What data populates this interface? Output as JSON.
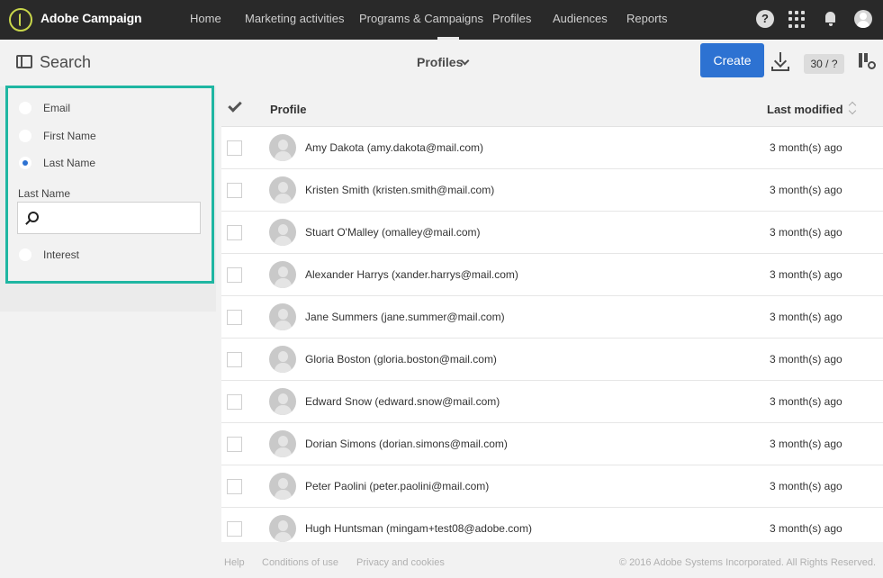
{
  "app": {
    "brand": "Adobe Campaign"
  },
  "nav": {
    "items": [
      {
        "label": "Home"
      },
      {
        "label": "Marketing activities"
      },
      {
        "label": "Programs & Campaigns"
      },
      {
        "label": "Profiles"
      },
      {
        "label": "Audiences"
      },
      {
        "label": "Reports"
      }
    ],
    "help_glyph": "?"
  },
  "toolbar": {
    "search_title": "Search",
    "view_selector": "Profiles",
    "create_label": "Create",
    "count": "30 / ?"
  },
  "filters": {
    "options": [
      {
        "label": "Email",
        "selected": false
      },
      {
        "label": "First Name",
        "selected": false
      },
      {
        "label": "Last Name",
        "selected": true
      },
      {
        "label": "Interest",
        "selected": false
      }
    ],
    "active_field_label": "Last Name",
    "search_value": ""
  },
  "table": {
    "columns": [
      "Profile",
      "Last modified"
    ],
    "rows": [
      {
        "name": "Amy Dakota (amy.dakota@mail.com)",
        "modified": "3 month(s) ago"
      },
      {
        "name": "Kristen Smith (kristen.smith@mail.com)",
        "modified": "3 month(s) ago"
      },
      {
        "name": "Stuart O'Malley (omalley@mail.com)",
        "modified": "3 month(s) ago"
      },
      {
        "name": "Alexander Harrys (xander.harrys@mail.com)",
        "modified": "3 month(s) ago"
      },
      {
        "name": "Jane Summers (jane.summer@mail.com)",
        "modified": "3 month(s) ago"
      },
      {
        "name": "Gloria Boston (gloria.boston@mail.com)",
        "modified": "3 month(s) ago"
      },
      {
        "name": "Edward Snow (edward.snow@mail.com)",
        "modified": "3 month(s) ago"
      },
      {
        "name": "Dorian Simons (dorian.simons@mail.com)",
        "modified": "3 month(s) ago"
      },
      {
        "name": "Peter Paolini (peter.paolini@mail.com)",
        "modified": "3 month(s) ago"
      },
      {
        "name": "Hugh Huntsman (mingam+test08@adobe.com)",
        "modified": "3 month(s) ago"
      }
    ]
  },
  "footer": {
    "links": [
      "Help",
      "Conditions of use",
      "Privacy and cookies"
    ],
    "copyright": "© 2016 Adobe Systems Incorporated. All Rights Reserved."
  },
  "colors": {
    "topbar": "#292929",
    "accent_blue": "#2d72d2",
    "filter_highlight": "#1fb6a2",
    "logo": "#c8d64a"
  },
  "icons": [
    "adobe-campaign-logo-icon",
    "help-icon",
    "apps-grid-icon",
    "bell-icon",
    "user-avatar-icon",
    "panel-toggle-icon",
    "chevron-down-icon",
    "download-icon",
    "columns-settings-icon",
    "search-icon",
    "checkmark-icon",
    "sort-icon",
    "profile-avatar-icon"
  ]
}
